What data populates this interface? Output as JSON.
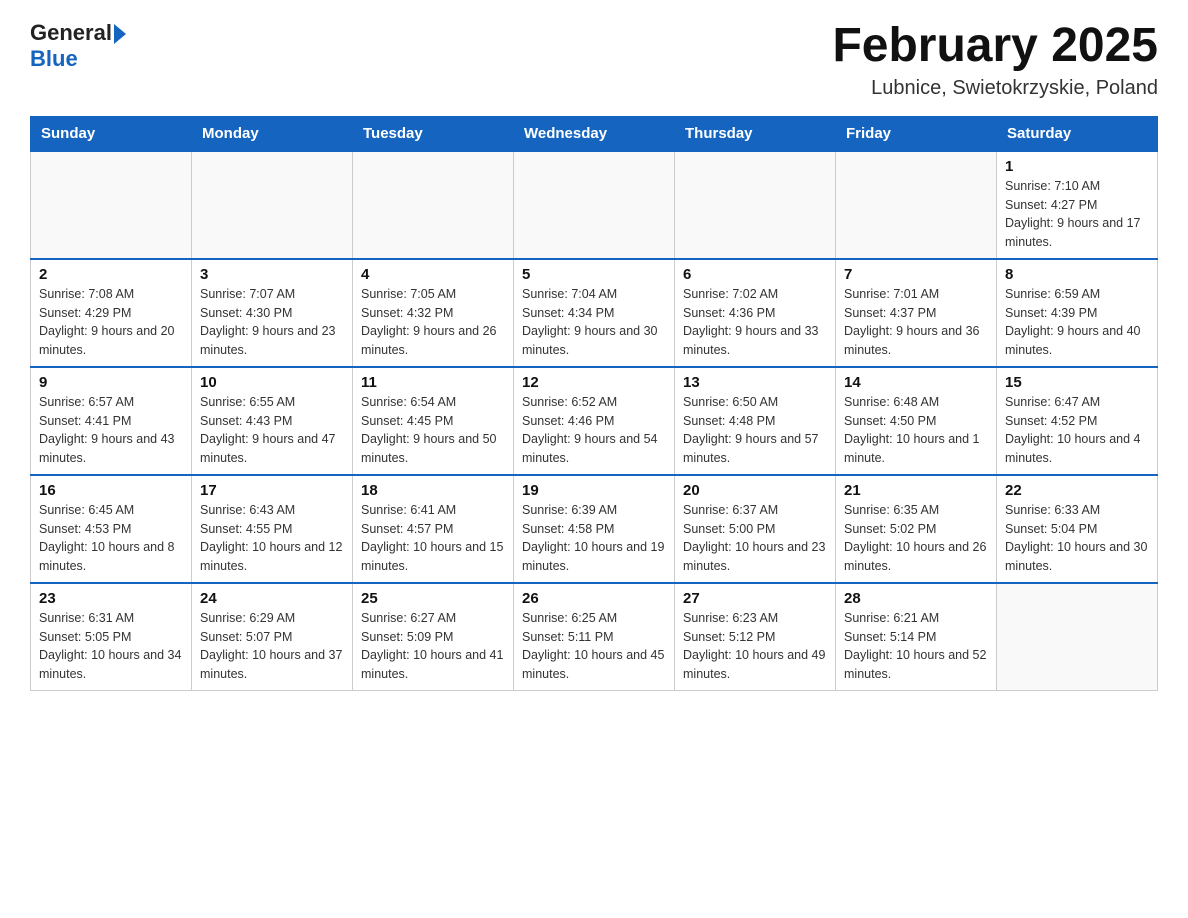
{
  "header": {
    "logo_general": "General",
    "logo_blue": "Blue",
    "month_title": "February 2025",
    "location": "Lubnice, Swietokrzyskie, Poland"
  },
  "weekdays": [
    "Sunday",
    "Monday",
    "Tuesday",
    "Wednesday",
    "Thursday",
    "Friday",
    "Saturday"
  ],
  "weeks": [
    [
      {
        "day": "",
        "info": ""
      },
      {
        "day": "",
        "info": ""
      },
      {
        "day": "",
        "info": ""
      },
      {
        "day": "",
        "info": ""
      },
      {
        "day": "",
        "info": ""
      },
      {
        "day": "",
        "info": ""
      },
      {
        "day": "1",
        "info": "Sunrise: 7:10 AM\nSunset: 4:27 PM\nDaylight: 9 hours and 17 minutes."
      }
    ],
    [
      {
        "day": "2",
        "info": "Sunrise: 7:08 AM\nSunset: 4:29 PM\nDaylight: 9 hours and 20 minutes."
      },
      {
        "day": "3",
        "info": "Sunrise: 7:07 AM\nSunset: 4:30 PM\nDaylight: 9 hours and 23 minutes."
      },
      {
        "day": "4",
        "info": "Sunrise: 7:05 AM\nSunset: 4:32 PM\nDaylight: 9 hours and 26 minutes."
      },
      {
        "day": "5",
        "info": "Sunrise: 7:04 AM\nSunset: 4:34 PM\nDaylight: 9 hours and 30 minutes."
      },
      {
        "day": "6",
        "info": "Sunrise: 7:02 AM\nSunset: 4:36 PM\nDaylight: 9 hours and 33 minutes."
      },
      {
        "day": "7",
        "info": "Sunrise: 7:01 AM\nSunset: 4:37 PM\nDaylight: 9 hours and 36 minutes."
      },
      {
        "day": "8",
        "info": "Sunrise: 6:59 AM\nSunset: 4:39 PM\nDaylight: 9 hours and 40 minutes."
      }
    ],
    [
      {
        "day": "9",
        "info": "Sunrise: 6:57 AM\nSunset: 4:41 PM\nDaylight: 9 hours and 43 minutes."
      },
      {
        "day": "10",
        "info": "Sunrise: 6:55 AM\nSunset: 4:43 PM\nDaylight: 9 hours and 47 minutes."
      },
      {
        "day": "11",
        "info": "Sunrise: 6:54 AM\nSunset: 4:45 PM\nDaylight: 9 hours and 50 minutes."
      },
      {
        "day": "12",
        "info": "Sunrise: 6:52 AM\nSunset: 4:46 PM\nDaylight: 9 hours and 54 minutes."
      },
      {
        "day": "13",
        "info": "Sunrise: 6:50 AM\nSunset: 4:48 PM\nDaylight: 9 hours and 57 minutes."
      },
      {
        "day": "14",
        "info": "Sunrise: 6:48 AM\nSunset: 4:50 PM\nDaylight: 10 hours and 1 minute."
      },
      {
        "day": "15",
        "info": "Sunrise: 6:47 AM\nSunset: 4:52 PM\nDaylight: 10 hours and 4 minutes."
      }
    ],
    [
      {
        "day": "16",
        "info": "Sunrise: 6:45 AM\nSunset: 4:53 PM\nDaylight: 10 hours and 8 minutes."
      },
      {
        "day": "17",
        "info": "Sunrise: 6:43 AM\nSunset: 4:55 PM\nDaylight: 10 hours and 12 minutes."
      },
      {
        "day": "18",
        "info": "Sunrise: 6:41 AM\nSunset: 4:57 PM\nDaylight: 10 hours and 15 minutes."
      },
      {
        "day": "19",
        "info": "Sunrise: 6:39 AM\nSunset: 4:58 PM\nDaylight: 10 hours and 19 minutes."
      },
      {
        "day": "20",
        "info": "Sunrise: 6:37 AM\nSunset: 5:00 PM\nDaylight: 10 hours and 23 minutes."
      },
      {
        "day": "21",
        "info": "Sunrise: 6:35 AM\nSunset: 5:02 PM\nDaylight: 10 hours and 26 minutes."
      },
      {
        "day": "22",
        "info": "Sunrise: 6:33 AM\nSunset: 5:04 PM\nDaylight: 10 hours and 30 minutes."
      }
    ],
    [
      {
        "day": "23",
        "info": "Sunrise: 6:31 AM\nSunset: 5:05 PM\nDaylight: 10 hours and 34 minutes."
      },
      {
        "day": "24",
        "info": "Sunrise: 6:29 AM\nSunset: 5:07 PM\nDaylight: 10 hours and 37 minutes."
      },
      {
        "day": "25",
        "info": "Sunrise: 6:27 AM\nSunset: 5:09 PM\nDaylight: 10 hours and 41 minutes."
      },
      {
        "day": "26",
        "info": "Sunrise: 6:25 AM\nSunset: 5:11 PM\nDaylight: 10 hours and 45 minutes."
      },
      {
        "day": "27",
        "info": "Sunrise: 6:23 AM\nSunset: 5:12 PM\nDaylight: 10 hours and 49 minutes."
      },
      {
        "day": "28",
        "info": "Sunrise: 6:21 AM\nSunset: 5:14 PM\nDaylight: 10 hours and 52 minutes."
      },
      {
        "day": "",
        "info": ""
      }
    ]
  ]
}
